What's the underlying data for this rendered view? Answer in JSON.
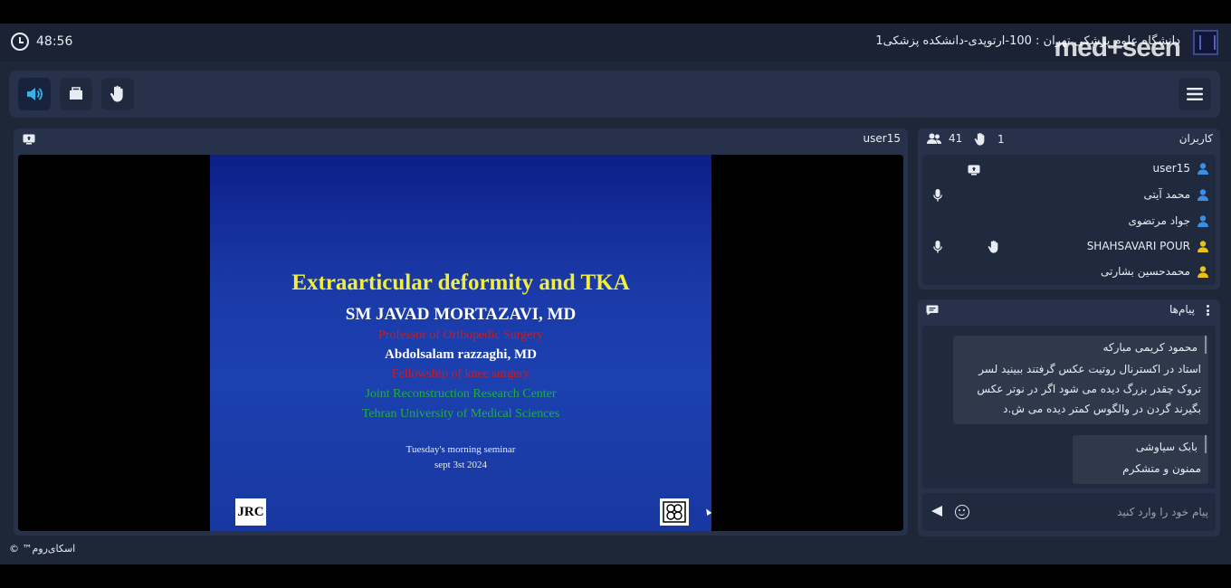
{
  "topbar": {
    "timer": "48:56",
    "room_title": "دانشگاه علوم پزشکی تهران : 100-ارتوپدی-دانشکده پزشکی1",
    "brand": "med+seen"
  },
  "toolbar": {
    "buttons": [
      {
        "icon": "speaker-icon",
        "active": true
      },
      {
        "icon": "folder-icon",
        "active": false
      },
      {
        "icon": "hand-icon",
        "active": false
      }
    ],
    "menu_icon": "hamburger-menu-icon"
  },
  "stage": {
    "presenter": "user15",
    "slide": {
      "title": "Extraarticular deformity and TKA",
      "author": "SM JAVAD MORTAZAVI, MD",
      "role": "Professor of Orthopedic Surgery",
      "coauthor": "Abdolsalam razzaghi, MD",
      "fellowship": "Fellowship of knee surgery",
      "center": "Joint Reconstruction Research Center",
      "university": "Tehran University of Medical Sciences",
      "seminar": "Tuesday's morning seminar",
      "date": "sept  3st  2024",
      "logo_left": "JRC"
    }
  },
  "users_panel": {
    "title": "کاربران",
    "participants_count": "41",
    "raised_hands": "1",
    "users": [
      {
        "name": "user15",
        "role_color": "#3a8ee6",
        "presenting": true,
        "mic": false,
        "hand": false
      },
      {
        "name": "محمد آیتی",
        "role_color": "#3a8ee6",
        "presenting": false,
        "mic": true,
        "hand": false
      },
      {
        "name": "جواد مرتضوی",
        "role_color": "#3a8ee6",
        "presenting": false,
        "mic": false,
        "hand": false
      },
      {
        "name": "SHAHSAVARI POUR",
        "role_color": "#e8c21a",
        "presenting": false,
        "mic": true,
        "hand": true
      },
      {
        "name": "محمدحسین بشارتی",
        "role_color": "#e8c21a",
        "presenting": false,
        "mic": false,
        "hand": false
      }
    ]
  },
  "chat": {
    "title": "پیام‌ها",
    "messages": [
      {
        "author": "محمود کریمی مبارکه",
        "text": "استاد در اکسترنال روتیت عکس گرفتند ببینید لسر تروک چقدر بزرگ دیده می شود اگر در نوتر عکس بگیرند گردن در والگوس کمتر دیده می ش.د"
      },
      {
        "author": "بابک سیاوشی",
        "text": "ممنون و متشکرم"
      }
    ],
    "input_placeholder": "پیام خود را وارد کنید"
  },
  "footer": {
    "copyright": "اسکای‌روم™ ©"
  }
}
